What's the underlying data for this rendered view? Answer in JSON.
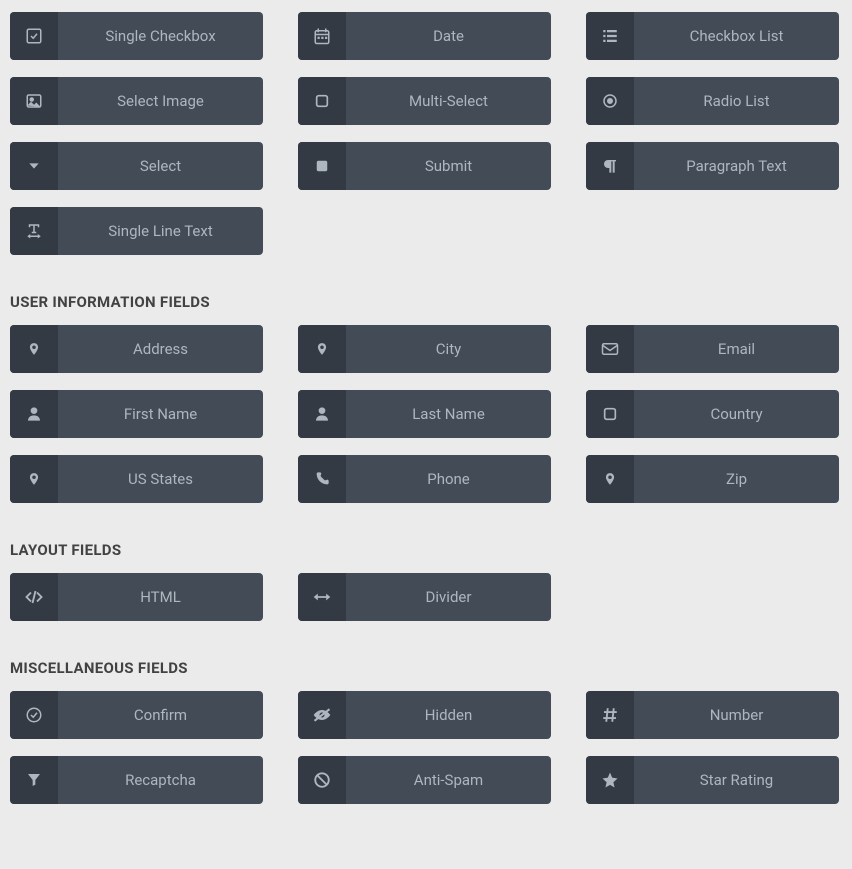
{
  "top_fields": [
    {
      "label": "Single Checkbox",
      "icon": "check-square-icon",
      "name": "field-single-checkbox"
    },
    {
      "label": "Date",
      "icon": "calendar-icon",
      "name": "field-date"
    },
    {
      "label": "Checkbox List",
      "icon": "list-icon",
      "name": "field-checkbox-list"
    },
    {
      "label": "Select Image",
      "icon": "image-icon",
      "name": "field-select-image"
    },
    {
      "label": "Multi-Select",
      "icon": "square-outline-icon",
      "name": "field-multi-select"
    },
    {
      "label": "Radio List",
      "icon": "radio-dot-icon",
      "name": "field-radio-list"
    },
    {
      "label": "Select",
      "icon": "chevron-down-icon",
      "name": "field-select"
    },
    {
      "label": "Submit",
      "icon": "square-filled-icon",
      "name": "field-submit"
    },
    {
      "label": "Paragraph Text",
      "icon": "paragraph-icon",
      "name": "field-paragraph-text"
    },
    {
      "label": "Single Line Text",
      "icon": "text-width-icon",
      "name": "field-single-line-text"
    }
  ],
  "sections": [
    {
      "heading": "USER INFORMATION FIELDS",
      "name": "user-information-fields-heading",
      "fields": [
        {
          "label": "Address",
          "icon": "map-marker-icon",
          "name": "field-address"
        },
        {
          "label": "City",
          "icon": "map-marker-icon",
          "name": "field-city"
        },
        {
          "label": "Email",
          "icon": "envelope-icon",
          "name": "field-email"
        },
        {
          "label": "First Name",
          "icon": "user-icon",
          "name": "field-first-name"
        },
        {
          "label": "Last Name",
          "icon": "user-icon",
          "name": "field-last-name"
        },
        {
          "label": "Country",
          "icon": "square-outline-icon",
          "name": "field-country"
        },
        {
          "label": "US States",
          "icon": "map-marker-icon",
          "name": "field-us-states"
        },
        {
          "label": "Phone",
          "icon": "phone-icon",
          "name": "field-phone"
        },
        {
          "label": "Zip",
          "icon": "map-marker-icon",
          "name": "field-zip"
        }
      ]
    },
    {
      "heading": "LAYOUT FIELDS",
      "name": "layout-fields-heading",
      "fields": [
        {
          "label": "HTML",
          "icon": "code-icon",
          "name": "field-html"
        },
        {
          "label": "Divider",
          "icon": "arrows-h-icon",
          "name": "field-divider"
        }
      ]
    },
    {
      "heading": "MISCELLANEOUS FIELDS",
      "name": "miscellaneous-fields-heading",
      "fields": [
        {
          "label": "Confirm",
          "icon": "check-circle-icon",
          "name": "field-confirm"
        },
        {
          "label": "Hidden",
          "icon": "eye-slash-icon",
          "name": "field-hidden"
        },
        {
          "label": "Number",
          "icon": "hash-icon",
          "name": "field-number"
        },
        {
          "label": "Recaptcha",
          "icon": "filter-icon",
          "name": "field-recaptcha"
        },
        {
          "label": "Anti-Spam",
          "icon": "ban-icon",
          "name": "field-anti-spam"
        },
        {
          "label": "Star Rating",
          "icon": "star-icon",
          "name": "field-star-rating"
        }
      ]
    }
  ]
}
